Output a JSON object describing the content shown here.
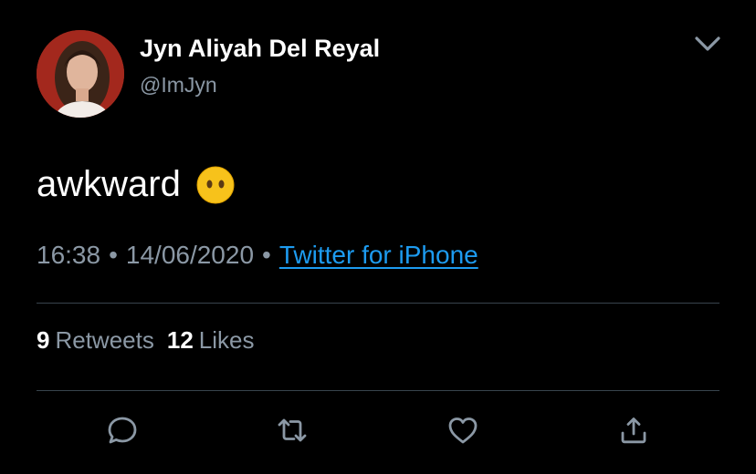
{
  "user": {
    "name": "Jyn Aliyah Del Reyal",
    "handle": "@ImJyn"
  },
  "tweet": {
    "text": "awkward",
    "emoji": "face-without-mouth",
    "time": "16:38",
    "separator": "•",
    "date": "14/06/2020",
    "source": "Twitter for iPhone"
  },
  "stats": {
    "retweets_count": "9",
    "retweets_label": "Retweets",
    "likes_count": "12",
    "likes_label": "Likes"
  },
  "colors": {
    "background": "#000000",
    "text": "#ffffff",
    "secondary": "#8b98a5",
    "link": "#1d9bf0",
    "divider": "#38444d"
  },
  "actions": [
    "reply-icon",
    "retweet-icon",
    "like-icon",
    "share-icon"
  ]
}
